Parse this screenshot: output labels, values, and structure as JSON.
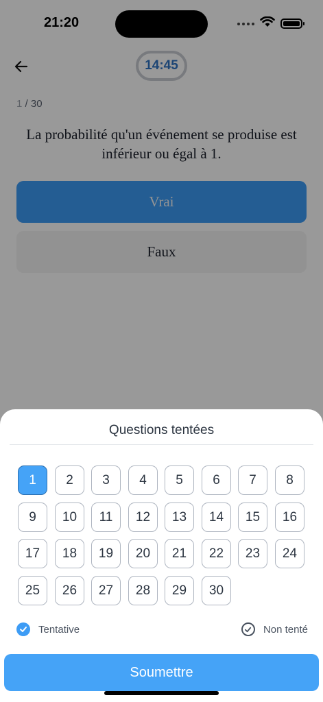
{
  "status_bar": {
    "time": "21:20"
  },
  "header": {
    "timer": "14:45"
  },
  "progress": {
    "current": "1",
    "separator": " / ",
    "total": "30"
  },
  "question": {
    "text": "La probabilité qu'un événement se produise est inférieur ou égal à 1."
  },
  "answers": [
    {
      "label": "Vrai"
    },
    {
      "label": "Faux"
    }
  ],
  "sheet": {
    "title": "Questions tentées",
    "selected_question": 1,
    "questions": [
      1,
      2,
      3,
      4,
      5,
      6,
      7,
      8,
      9,
      10,
      11,
      12,
      13,
      14,
      15,
      16,
      17,
      18,
      19,
      20,
      21,
      22,
      23,
      24,
      25,
      26,
      27,
      28,
      29,
      30
    ],
    "legend": {
      "attempted": "Tentative",
      "not_attempted": "Non tenté"
    },
    "submit_label": "Soumettre"
  },
  "colors": {
    "accent": "#45a3f7",
    "timer_text": "#2f74c4"
  },
  "icons": {
    "back": "arrow-left-icon",
    "wifi": "wifi-icon",
    "battery": "battery-icon",
    "signal": "signal-icon",
    "attempted": "check-circle-filled-icon",
    "not_attempted": "check-circle-outline-icon"
  }
}
